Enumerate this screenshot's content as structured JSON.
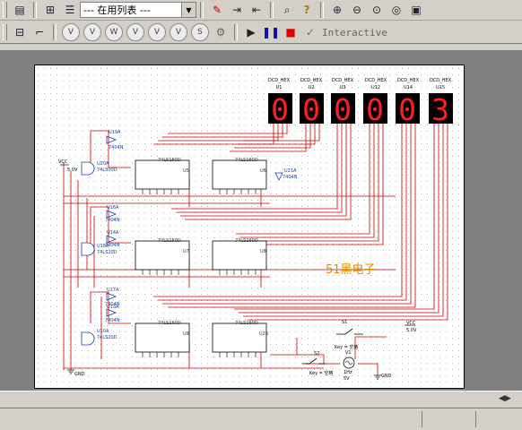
{
  "toolbar1": {
    "combo_value": "--- 在用列表 ---",
    "icons": [
      "bom-icon",
      "tree-icon",
      "list-icon",
      "probe-icon",
      "postprocess-icon",
      "back-annotate-icon",
      "zoom-search-icon",
      "help-icon",
      "zoom-in-icon",
      "zoom-out-icon",
      "zoom-area-icon",
      "zoom-fit-icon",
      "fullscreen-icon"
    ]
  },
  "toolbar2": {
    "sim_buttons": [
      "V",
      "V",
      "W",
      "V",
      "V",
      "V",
      "S"
    ],
    "mode": "Interactive"
  },
  "schematic": {
    "displays": [
      {
        "type": "DCD_HEX",
        "ref": "U1",
        "digit": "0"
      },
      {
        "type": "DCD_HEX",
        "ref": "U2",
        "digit": "0"
      },
      {
        "type": "DCD_HEX",
        "ref": "U3",
        "digit": "0"
      },
      {
        "type": "DCD_HEX",
        "ref": "U12",
        "digit": "0"
      },
      {
        "type": "DCD_HEX",
        "ref": "U14",
        "digit": "0"
      },
      {
        "type": "DCD_HEX",
        "ref": "U15",
        "digit": "3"
      }
    ],
    "counters": [
      {
        "part": "74LS160D",
        "ref": "U5"
      },
      {
        "part": "74LS160D",
        "ref": "U6"
      },
      {
        "part": "74LS160D",
        "ref": "U7"
      },
      {
        "part": "74LS160D",
        "ref": "U8"
      },
      {
        "part": "74LS160D",
        "ref": "U9"
      },
      {
        "part": "74LS160D",
        "ref": "U23"
      }
    ],
    "inverters": [
      {
        "ref": "U19A",
        "part": "7404N"
      },
      {
        "ref": "U21A",
        "part": "7404N"
      },
      {
        "ref": "U16A",
        "part": "7404N"
      },
      {
        "ref": "U14A",
        "part": "7404N"
      },
      {
        "ref": "U17A",
        "part": "7404N"
      },
      {
        "ref": "U13A",
        "part": "7404N"
      }
    ],
    "nand_gates": [
      {
        "ref": "U20A",
        "part": "74LS00D"
      },
      {
        "ref": "U18A",
        "part": "74LS20D"
      },
      {
        "ref": "U10A",
        "part": "74LS20D"
      }
    ],
    "vcc_left": {
      "label": "VCC",
      "value": "5.0V"
    },
    "vcc_right": {
      "label": "VCC",
      "value": "5.0V"
    },
    "gnd_labels": [
      "GND",
      "GND"
    ],
    "switch1": {
      "ref": "S1",
      "key": "Key = 空格"
    },
    "switch2": {
      "ref": "S2",
      "key": "Key = 空格"
    },
    "source": {
      "ref": "V1",
      "freq": "1Hz",
      "amp": "5V"
    },
    "watermark": "51黑电子"
  }
}
